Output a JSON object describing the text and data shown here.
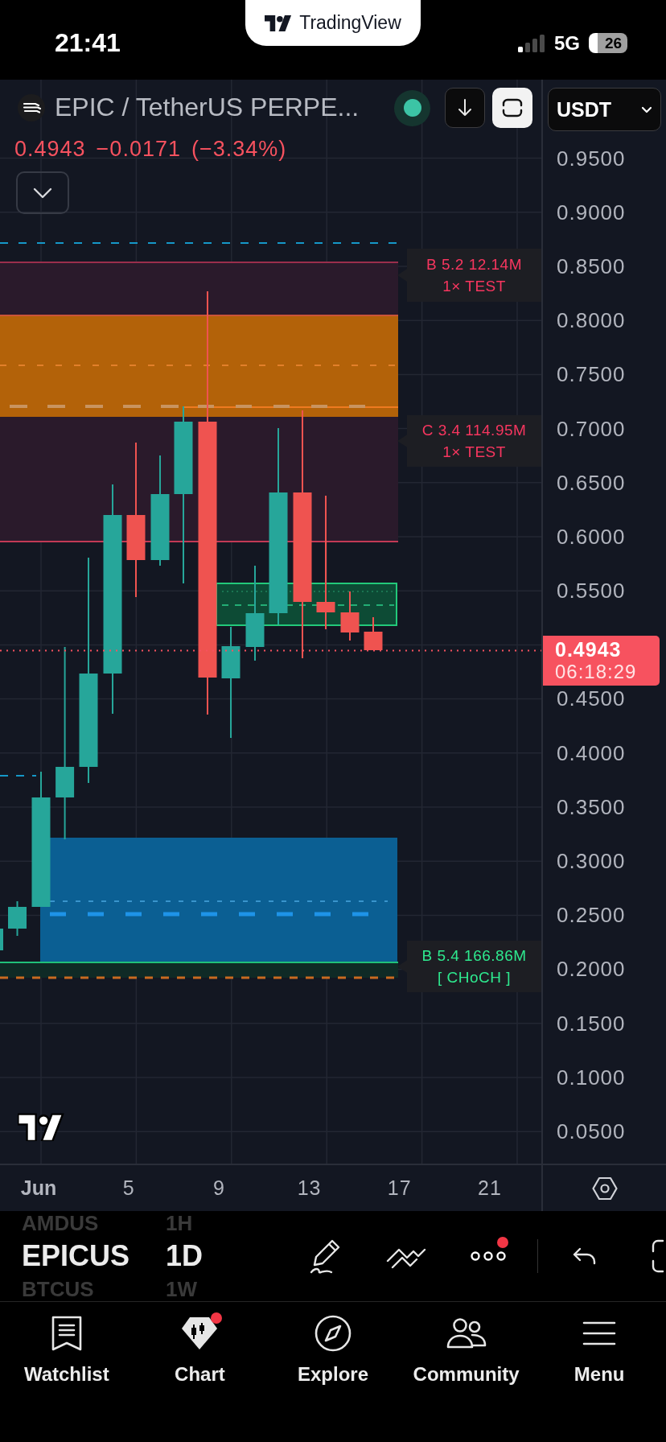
{
  "status_bar": {
    "time": "21:41",
    "network": "5G",
    "battery": "26"
  },
  "app_banner": {
    "title": "TradingView"
  },
  "chart_header": {
    "symbol": "EPIC / TetherUS PERPE...",
    "market_open": true,
    "currency": "USDT"
  },
  "quote": {
    "negative": true,
    "price": "0.4943",
    "change": "−0.0171",
    "change_percent": "(−3.34%)"
  },
  "chart_labels": [
    {
      "kind": "bearish",
      "lines": [
        "B 5.2 12.14M",
        "1× TEST"
      ]
    },
    {
      "kind": "bearish",
      "lines": [
        "C 3.4 114.95M",
        "1× TEST"
      ]
    },
    {
      "kind": "bullish",
      "lines": [
        "B 5.4 166.86M",
        "[ CHoCH ]"
      ]
    }
  ],
  "price_axis": {
    "upper_labels": [
      "0.9500",
      "0.9000",
      "0.8500",
      "0.8000",
      "0.7500",
      "0.7000",
      "0.6500",
      "0.6000",
      "0.5500"
    ],
    "price_tag": {
      "price": "0.4943",
      "countdown": "06:18:29"
    },
    "lower_labels": [
      "0.4500",
      "0.4000",
      "0.3500",
      "0.3000",
      "0.2500",
      "0.2000",
      "0.1500",
      "0.1000",
      "0.0500"
    ]
  },
  "time_axis": {
    "labels": [
      {
        "kind": "month",
        "text": "Jun"
      },
      {
        "kind": "day",
        "text": "5"
      },
      {
        "kind": "day",
        "text": "9"
      },
      {
        "kind": "day",
        "text": "13"
      },
      {
        "kind": "day",
        "text": "17"
      },
      {
        "kind": "day",
        "text": "21"
      }
    ]
  },
  "toolbar": {
    "symbols": [
      {
        "symbol": "AMDUS",
        "interval": "1H",
        "selected": false
      },
      {
        "symbol": "EPICUS",
        "interval": "1D",
        "selected": true
      },
      {
        "symbol": "BTCUS",
        "interval": "1W",
        "selected": false
      }
    ],
    "more_notification": true
  },
  "bottom_nav": [
    {
      "label": "Watchlist",
      "notification": false
    },
    {
      "label": "Chart",
      "notification": true
    },
    {
      "label": "Explore",
      "notification": false
    },
    {
      "label": "Community",
      "notification": false
    },
    {
      "label": "Menu",
      "notification": false
    }
  ]
}
